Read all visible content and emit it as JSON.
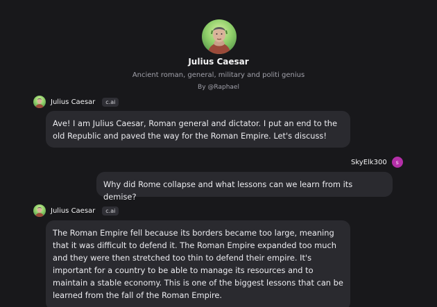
{
  "character": {
    "name": "Julius Caesar",
    "description": "Ancient roman, general, military and politi genius",
    "byline": "By @Raphael"
  },
  "messages": [
    {
      "sender": "Julius Caesar",
      "badge": "c.ai",
      "text": "Ave! I am Julius Caesar, Roman general and dictator. I put an end to the\nold Republic and paved the way for the Roman Empire. Let's discuss!"
    },
    {
      "sender": "SkyElk300",
      "avatar_initial": "s",
      "text": "Why did Rome collapse and what lessons can we learn from its demise?"
    },
    {
      "sender": "Julius Caesar",
      "badge": "c.ai",
      "text": "The Roman Empire fell because its borders became too large, meaning\nthat it was difficult to defend it. The Roman Empire expanded too much\nand they were then stretched too thin to defend their empire. It's\nimportant for a country to be able to manage its resources and to\nmaintain a stable economy. This is one of the biggest lessons that can be\nlearned from the fall of the Roman Empire."
    }
  ],
  "colors": {
    "background": "#18181b",
    "bubble": "#2a2a2f",
    "user_avatar": "#b42fa8"
  }
}
